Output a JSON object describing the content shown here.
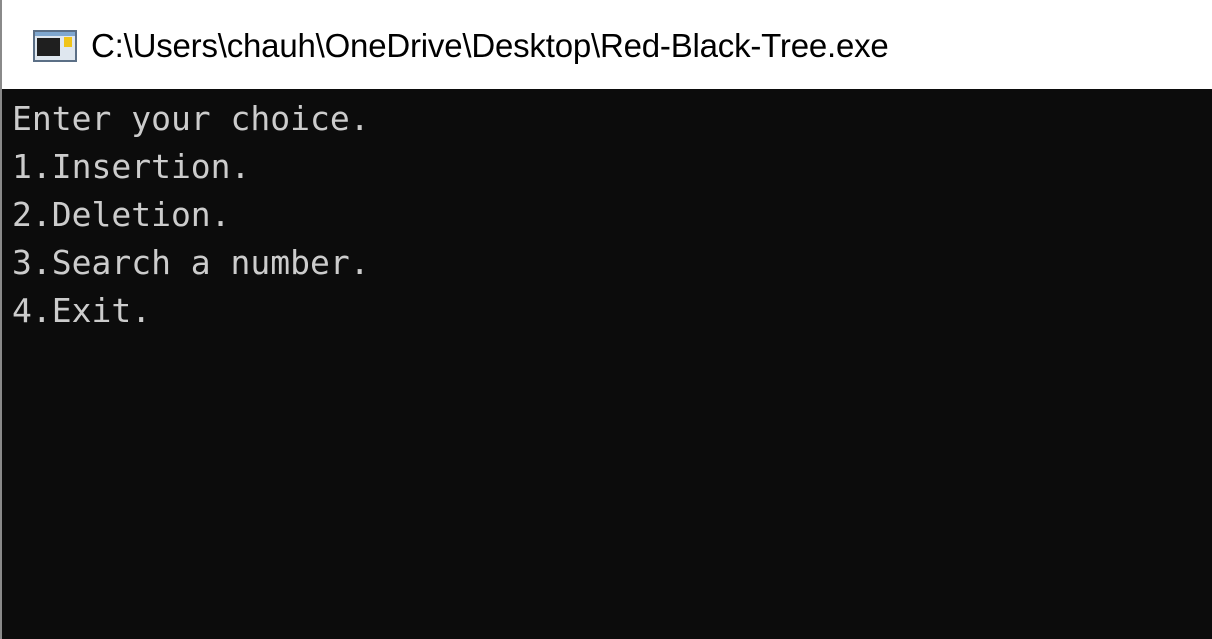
{
  "window": {
    "title": "C:\\Users\\chauh\\OneDrive\\Desktop\\Red-Black-Tree.exe",
    "icon": "console-app-icon"
  },
  "console": {
    "background": "#0c0c0c",
    "text_color": "#cccccc",
    "lines": [
      "Enter your choice.",
      "1.Insertion.",
      "2.Deletion.",
      "3.Search a number.",
      "4.Exit."
    ]
  }
}
